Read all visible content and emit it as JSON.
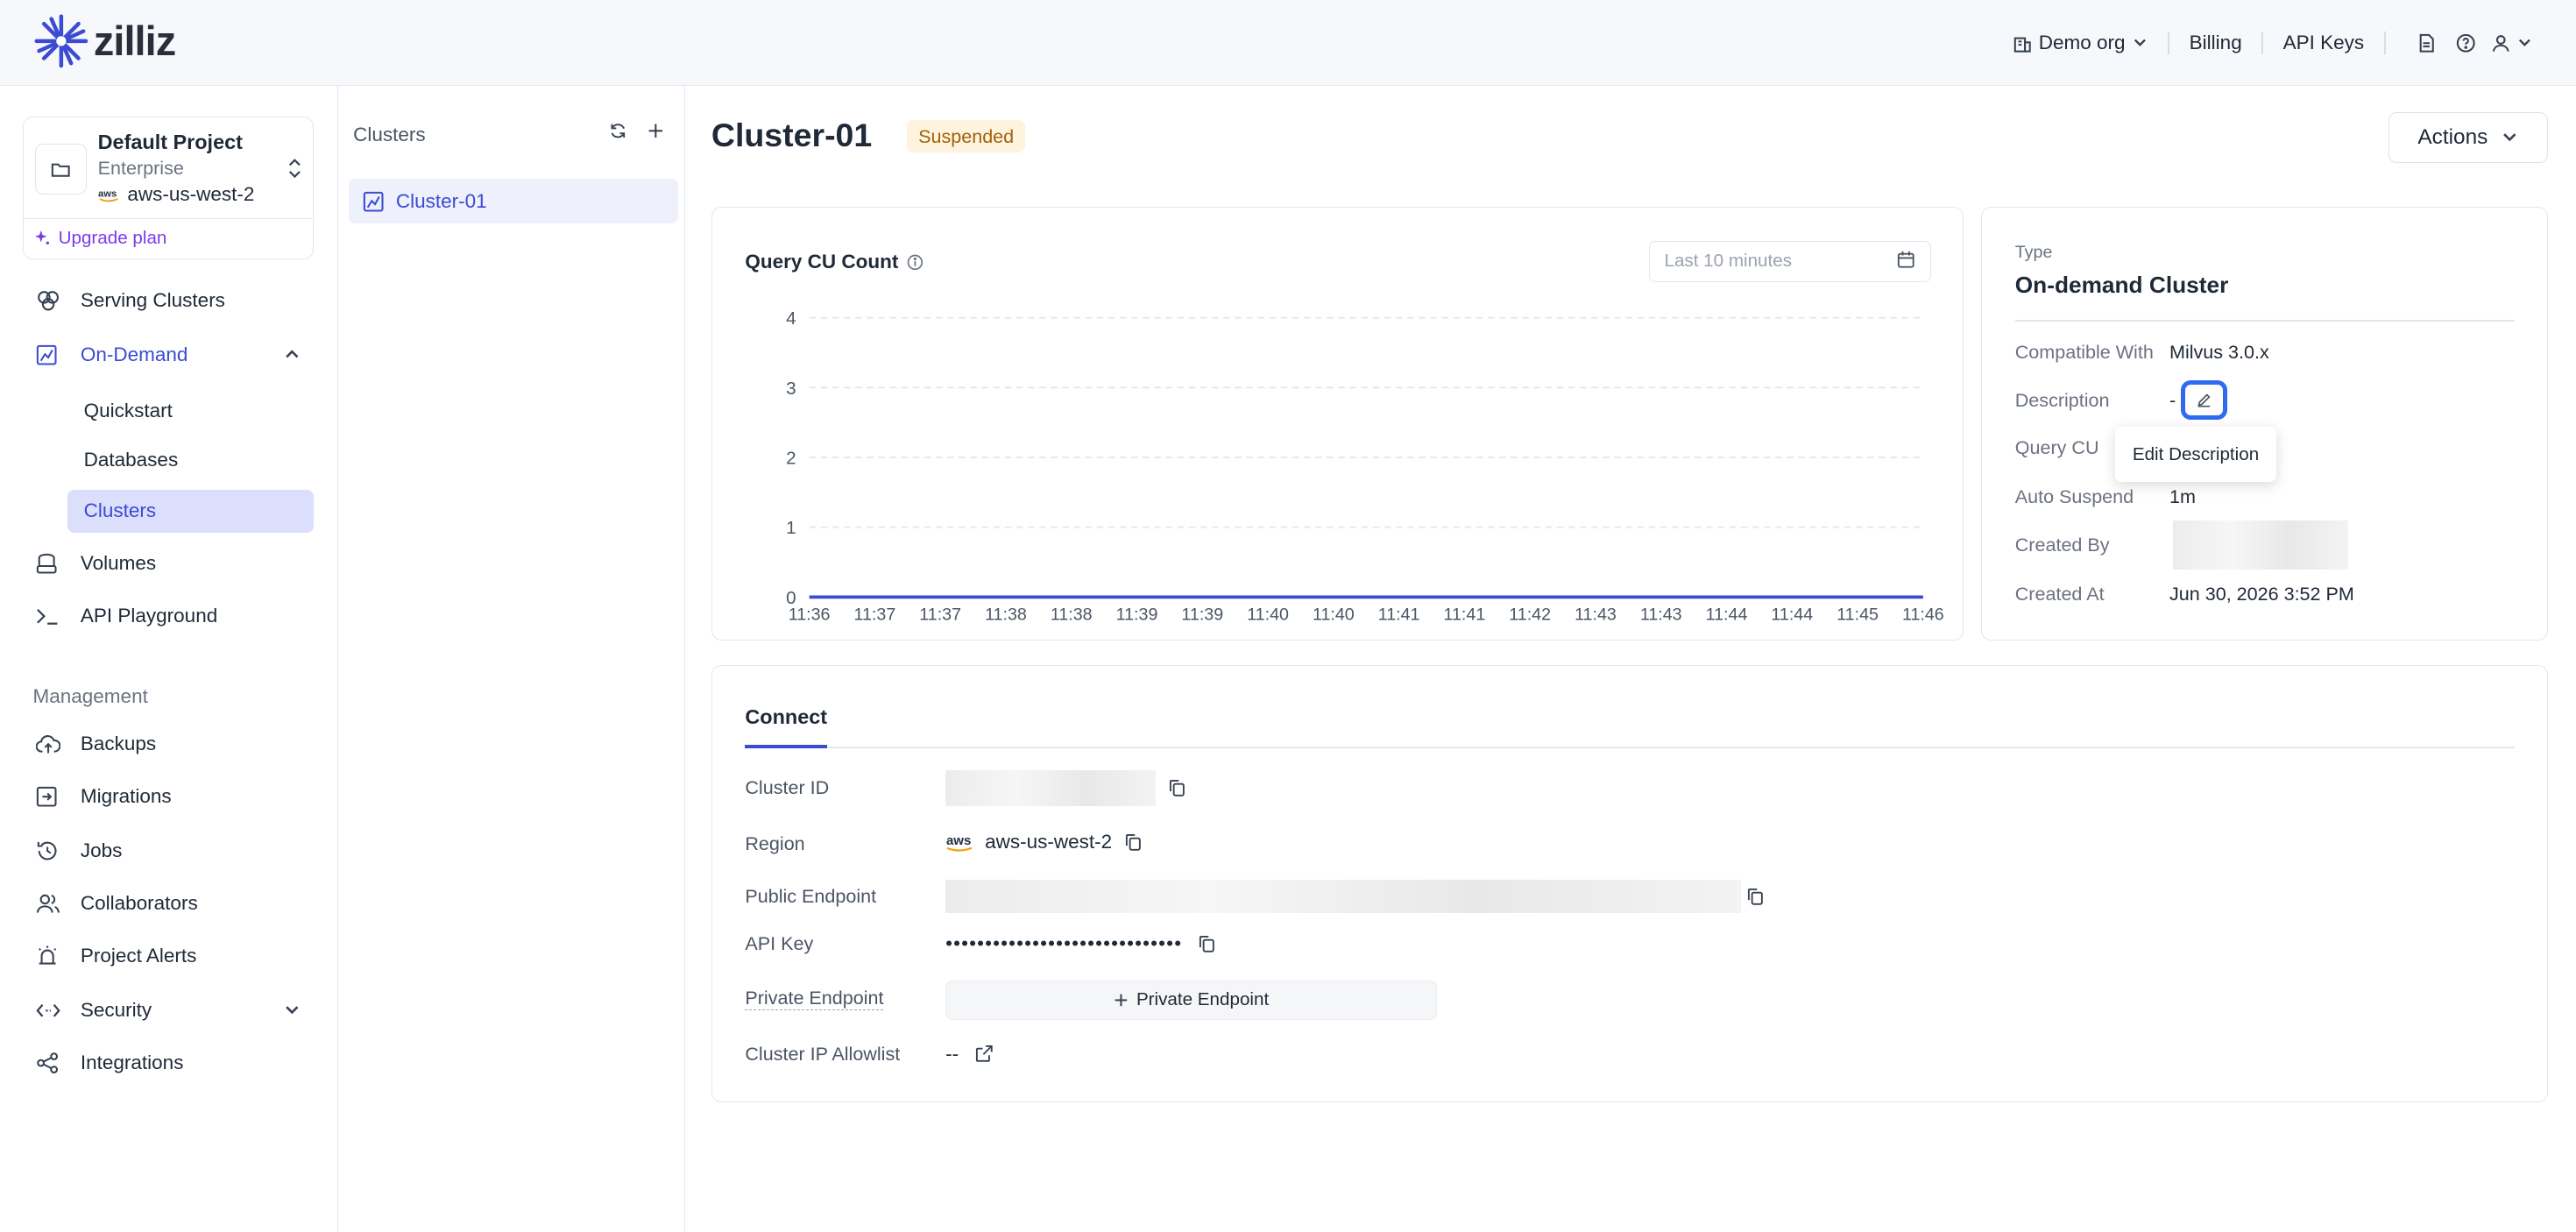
{
  "brand": {
    "name": "zilliz",
    "accent": "#3b4bd2"
  },
  "topnav": {
    "org": "Demo org",
    "billing": "Billing",
    "api_keys": "API Keys"
  },
  "project": {
    "name": "Default Project",
    "tier": "Enterprise",
    "region": "aws-us-west-2",
    "upgrade": "Upgrade plan"
  },
  "sidebar": {
    "serving_clusters": "Serving Clusters",
    "on_demand": "On-Demand",
    "sub": {
      "quickstart": "Quickstart",
      "databases": "Databases",
      "clusters": "Clusters"
    },
    "volumes": "Volumes",
    "api_playground": "API Playground",
    "management_heading": "Management",
    "backups": "Backups",
    "migrations": "Migrations",
    "jobs": "Jobs",
    "collaborators": "Collaborators",
    "project_alerts": "Project Alerts",
    "security": "Security",
    "integrations": "Integrations"
  },
  "cluster_list": {
    "title": "Clusters",
    "items": [
      "Cluster-01"
    ]
  },
  "cluster": {
    "name": "Cluster-01",
    "status": "Suspended",
    "actions": "Actions"
  },
  "chart_card": {
    "title": "Query CU Count",
    "range_placeholder": "Last 10 minutes"
  },
  "chart_data": {
    "type": "line",
    "title": "Query CU Count",
    "x": [
      "11:36",
      "11:37",
      "11:37",
      "11:38",
      "11:38",
      "11:39",
      "11:39",
      "11:40",
      "11:40",
      "11:41",
      "11:41",
      "11:42",
      "11:43",
      "11:43",
      "11:44",
      "11:44",
      "11:45",
      "11:46"
    ],
    "y_ticks": [
      0,
      1,
      2,
      3,
      4
    ],
    "ylim": [
      0,
      4
    ],
    "series": [
      {
        "values": [
          0,
          0,
          0,
          0,
          0,
          0,
          0,
          0,
          0,
          0,
          0,
          0,
          0,
          0,
          0,
          0,
          0,
          0
        ],
        "color": "#3b4bd2"
      }
    ],
    "grid": true
  },
  "info": {
    "type_label": "Type",
    "type_value": "On-demand Cluster",
    "rows": {
      "compatible_label": "Compatible With",
      "compatible_value": "Milvus 3.0.x",
      "description_label": "Description",
      "description_value": "-",
      "query_cu_label": "Query CU",
      "auto_suspend_label": "Auto Suspend",
      "auto_suspend_value": "1m",
      "created_by_label": "Created By",
      "created_at_label": "Created At",
      "created_at_value": "Jun 30, 2026 3:52 PM"
    },
    "tooltip": "Edit Description"
  },
  "connect": {
    "tab": "Connect",
    "cluster_id_label": "Cluster ID",
    "region_label": "Region",
    "region_value": "aws-us-west-2",
    "public_endpoint_label": "Public Endpoint",
    "api_key_label": "API Key",
    "api_key_value": "••••••••••••••••••••••••••••••",
    "private_endpoint_label": "Private Endpoint",
    "private_endpoint_button": "Private Endpoint",
    "allowlist_label": "Cluster IP Allowlist",
    "allowlist_value": "--"
  }
}
